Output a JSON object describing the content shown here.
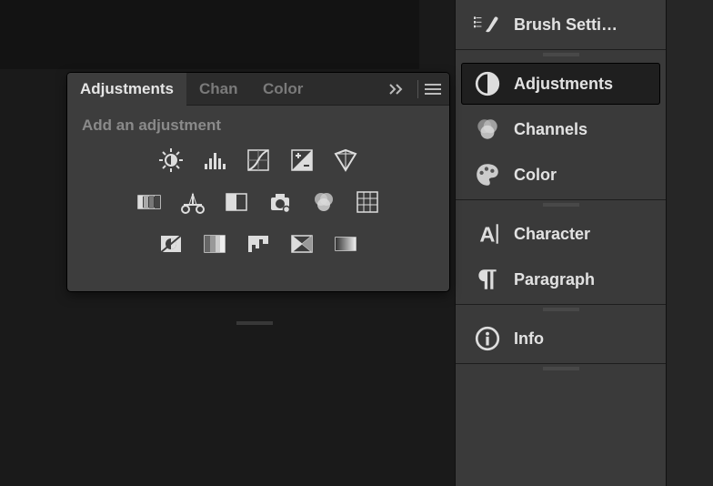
{
  "panel": {
    "tabs": [
      "Adjustments",
      "Chan",
      "Color"
    ],
    "activeTab": 0,
    "hint": "Add an adjustment"
  },
  "sidebar": {
    "brush": "Brush Setti…",
    "adjustments": "Adjustments",
    "channels": "Channels",
    "color": "Color",
    "character": "Character",
    "paragraph": "Paragraph",
    "info": "Info"
  }
}
